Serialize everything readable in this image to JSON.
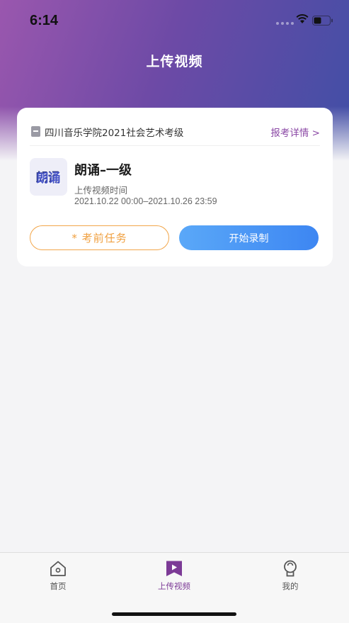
{
  "status_bar": {
    "time": "6:14"
  },
  "nav": {
    "title": "上传视频"
  },
  "card": {
    "org_name": "四川音乐学院2021社会艺术考级",
    "detail_link": "报考详情 >",
    "thumb_text": "朗诵",
    "exam_title": "朗诵–一级",
    "time_label": "上传视频时间",
    "time_range": "2021.10.22 00:00–2021.10.26 23:59",
    "task_button": "* 考前任务",
    "record_button": "开始录制"
  },
  "tabbar": {
    "items": [
      {
        "label": "首页",
        "icon": "home-icon",
        "active": false
      },
      {
        "label": "上传视频",
        "icon": "upload-video-icon",
        "active": true
      },
      {
        "label": "我的",
        "icon": "profile-icon",
        "active": false
      }
    ]
  },
  "colors": {
    "header_gradient_start": "#9a57ae",
    "header_gradient_end": "#3f4fa6",
    "accent_purple": "#8c4aa6",
    "task_orange": "#f0a040",
    "record_blue": "#3d86f2"
  }
}
